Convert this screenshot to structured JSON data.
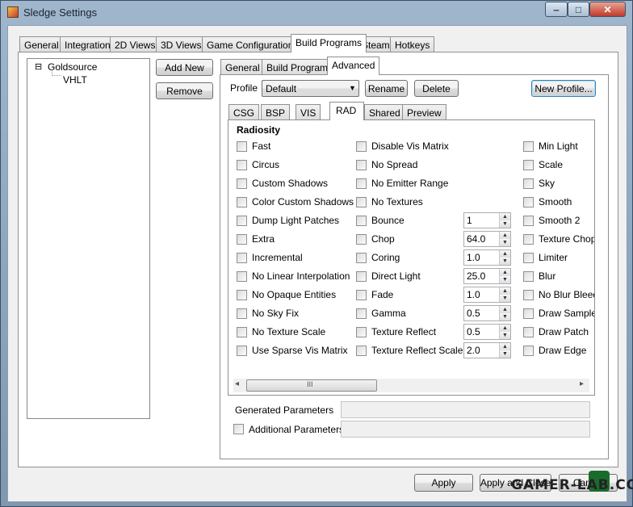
{
  "window": {
    "title": "Sledge Settings",
    "minimize": "‒",
    "maximize": "□",
    "close": "✕"
  },
  "main_tabs": [
    "General",
    "Integration",
    "2D Views",
    "3D Views",
    "Game Configurations",
    "Build Programs",
    "Steam",
    "Hotkeys"
  ],
  "tree": {
    "root": "Goldsource",
    "child": "VHLT",
    "expander": "⊟"
  },
  "side_buttons": {
    "add_new": "Add New",
    "remove": "Remove"
  },
  "sub_tabs": [
    "General",
    "Build Programs",
    "Advanced"
  ],
  "profile": {
    "label": "Profile",
    "value": "Default",
    "rename": "Rename",
    "delete": "Delete",
    "new_profile": "New Profile..."
  },
  "tool_tabs": [
    "CSG",
    "BSP",
    "VIS",
    "RAD",
    "Shared",
    "Preview"
  ],
  "section_title": "Radiosity",
  "col1": [
    "Fast",
    "Circus",
    "Custom Shadows",
    "Color Custom Shadows",
    "Dump Light Patches",
    "Extra",
    "Incremental",
    "No Linear Interpolation",
    "No Opaque Entities",
    "No Sky Fix",
    "No Texture Scale",
    "Use Sparse Vis Matrix"
  ],
  "col2": [
    "Disable Vis Matrix",
    "No Spread",
    "No Emitter Range",
    "No Textures",
    "Bounce",
    "Chop",
    "Coring",
    "Direct Light",
    "Fade",
    "Gamma",
    "Texture Reflect",
    "Texture Reflect Scale"
  ],
  "numeric": [
    "1",
    "64.0",
    "1.0",
    "25.0",
    "1.0",
    "0.5",
    "0.5",
    "2.0"
  ],
  "col3": [
    "Min Light",
    "Scale",
    "Sky",
    "Smooth",
    "Smooth 2",
    "Texture Chop",
    "Limiter",
    "Blur",
    "No Blur Bleed",
    "Draw Sample",
    "Draw Patch",
    "Draw Edge"
  ],
  "scroll": {
    "left": "◂",
    "right": "▸",
    "grip": "III"
  },
  "generated_label": "Generated Parameters",
  "additional_label": "Additional Parameters",
  "bottom": {
    "apply": "Apply",
    "apply_close": "Apply and Close",
    "cancel": "Cancel"
  },
  "watermark": "GAMER-LAB.COM"
}
